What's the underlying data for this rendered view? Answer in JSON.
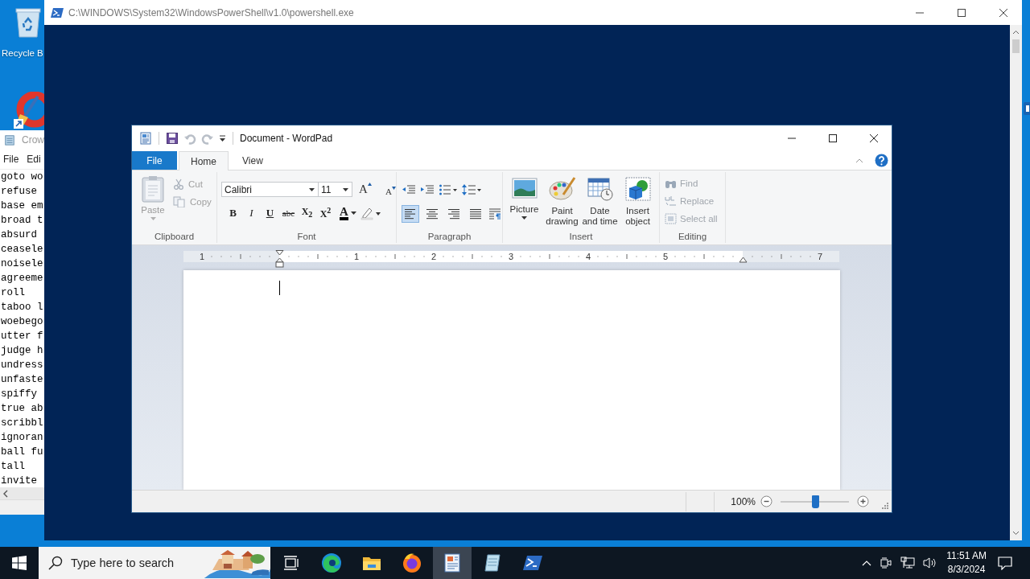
{
  "desktop": {
    "icons": [
      {
        "kind": "recycle-bin",
        "label": "Recycle B"
      },
      {
        "kind": "cleaner-shortcut"
      },
      {
        "kind": "edge-fragment"
      }
    ]
  },
  "notepad": {
    "title": "Crow",
    "menu": [
      "File",
      "Edi"
    ],
    "lines": [
      "goto wo",
      "refuse",
      "base em",
      "broad t",
      "absurd",
      "ceasele",
      "noisele",
      "agreeme",
      "roll",
      "taboo l",
      "woebego",
      "utter f",
      "judge h",
      "undress",
      "unfaste",
      "spiffy",
      "true ab",
      "scribbl",
      "ignoran",
      "ball fu",
      "tall",
      "invite"
    ]
  },
  "powershell": {
    "title": "C:\\WINDOWS\\System32\\WindowsPowerShell\\v1.0\\powershell.exe"
  },
  "wordpad": {
    "title": "Document - WordPad",
    "file_menu": "File",
    "tabs": [
      {
        "label": "Home",
        "selected": true
      },
      {
        "label": "View",
        "selected": false
      }
    ],
    "clipboard": {
      "label": "Clipboard",
      "paste": {
        "label": "Paste",
        "disabled": true
      },
      "items": [
        {
          "kind": "cut",
          "label": "Cut",
          "disabled": true
        },
        {
          "kind": "copy",
          "label": "Copy",
          "disabled": true
        }
      ]
    },
    "font": {
      "label": "Font",
      "family": "Calibri",
      "size": "11",
      "size_buttons": [
        {
          "kind": "grow",
          "label": "A"
        },
        {
          "kind": "shrink",
          "label": "A"
        }
      ],
      "styles": [
        {
          "kind": "bold",
          "label": "B"
        },
        {
          "kind": "italic",
          "label": "I"
        },
        {
          "kind": "underline",
          "label": "U"
        },
        {
          "kind": "strike",
          "label": "abc"
        },
        {
          "kind": "subscript",
          "label": "X$_{2}$"
        },
        {
          "kind": "superscript",
          "label": "X$^{2}$"
        }
      ],
      "color_label": "A"
    },
    "paragraph": {
      "label": "Paragraph",
      "align": [
        {
          "kind": "left",
          "selected": true
        },
        {
          "kind": "center",
          "selected": false
        },
        {
          "kind": "right",
          "selected": false
        },
        {
          "kind": "justify",
          "selected": false
        }
      ]
    },
    "insert": {
      "label": "Insert",
      "items": [
        {
          "kind": "picture",
          "label": "Picture",
          "dropdown": true
        },
        {
          "kind": "paint",
          "label": "Paint drawing",
          "dropdown": false
        },
        {
          "kind": "datetime",
          "label": "Date and time",
          "dropdown": false
        },
        {
          "kind": "object",
          "label": "Insert object",
          "dropdown": false
        }
      ]
    },
    "editing": {
      "label": "Editing",
      "items": [
        {
          "kind": "find",
          "label": "Find",
          "disabled": true
        },
        {
          "kind": "replace",
          "label": "Replace",
          "disabled": true
        },
        {
          "kind": "select-all",
          "label": "Select all",
          "disabled": true
        }
      ]
    },
    "ruler": {
      "stops": [
        {
          "kind": "number",
          "label": "1"
        },
        {
          "kind": "left-indent"
        },
        {
          "kind": "number",
          "label": "1"
        },
        {
          "kind": "number",
          "label": "2"
        },
        {
          "kind": "number",
          "label": "3"
        },
        {
          "kind": "number",
          "label": "4"
        },
        {
          "kind": "number",
          "label": "5"
        },
        {
          "kind": "right-indent"
        },
        {
          "kind": "number",
          "label": "7"
        }
      ]
    },
    "zoom": {
      "label": "100%",
      "level": 0.5
    }
  },
  "taskbar": {
    "search_placeholder": "Type here to search",
    "apps": [
      {
        "kind": "task-view",
        "selected": false
      },
      {
        "kind": "edge",
        "selected": false
      },
      {
        "kind": "explorer",
        "selected": false
      },
      {
        "kind": "firefox",
        "selected": false
      },
      {
        "kind": "wordpad",
        "selected": true
      },
      {
        "kind": "notepad",
        "selected": false
      },
      {
        "kind": "powershell",
        "selected": false
      }
    ],
    "time": "11:51 AM",
    "date": "8/3/2024"
  }
}
